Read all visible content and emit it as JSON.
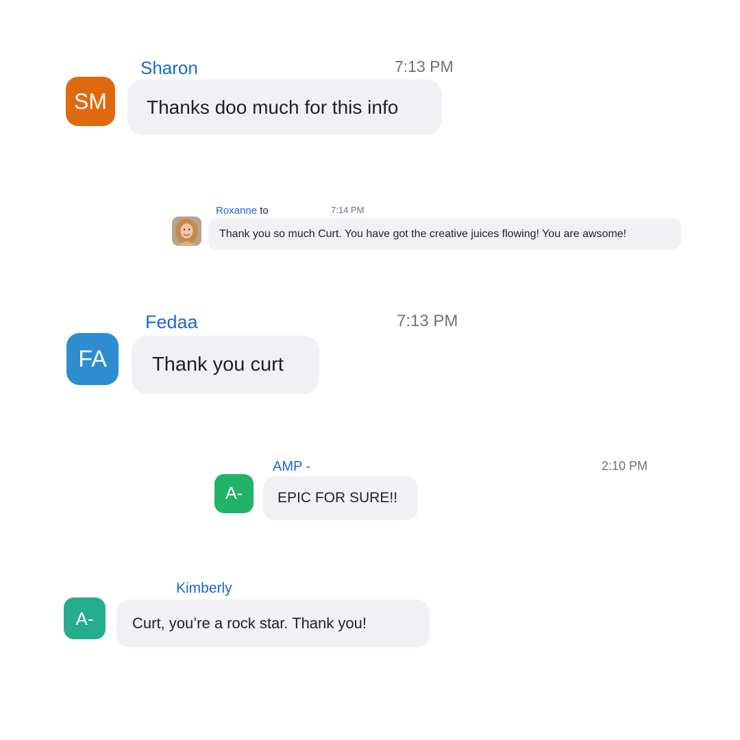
{
  "messages": [
    {
      "sender": "Sharon",
      "time": "7:13 PM",
      "avatar_initials": "SM",
      "avatar_color": "#e0690f",
      "text": "Thanks doo much for this info"
    },
    {
      "sender": "Roxanne",
      "recipient_prefix": "to",
      "time": "7:14 PM",
      "avatar_type": "photo",
      "text": "Thank you so much Curt. You have got the creative juices flowing! You are awsome!"
    },
    {
      "sender": "Fedaa",
      "time": "7:13 PM",
      "avatar_initials": "FA",
      "avatar_color": "#2f8ccf",
      "text": "Thank you curt"
    },
    {
      "sender": "AMP -",
      "time": "2:10 PM",
      "avatar_initials": "A-",
      "avatar_color": "#22b268",
      "text": "EPIC FOR SURE!!"
    },
    {
      "sender": "Kimberly",
      "avatar_initials": "A-",
      "avatar_color": "#25ad8d",
      "text": "Curt, you’re a rock star. Thank you!"
    }
  ],
  "colors": {
    "sender_name": "#1a66d6",
    "timestamp": "#6f6f78",
    "bubble_background": "#f1f1f5",
    "message_text": "#1f1f24"
  }
}
